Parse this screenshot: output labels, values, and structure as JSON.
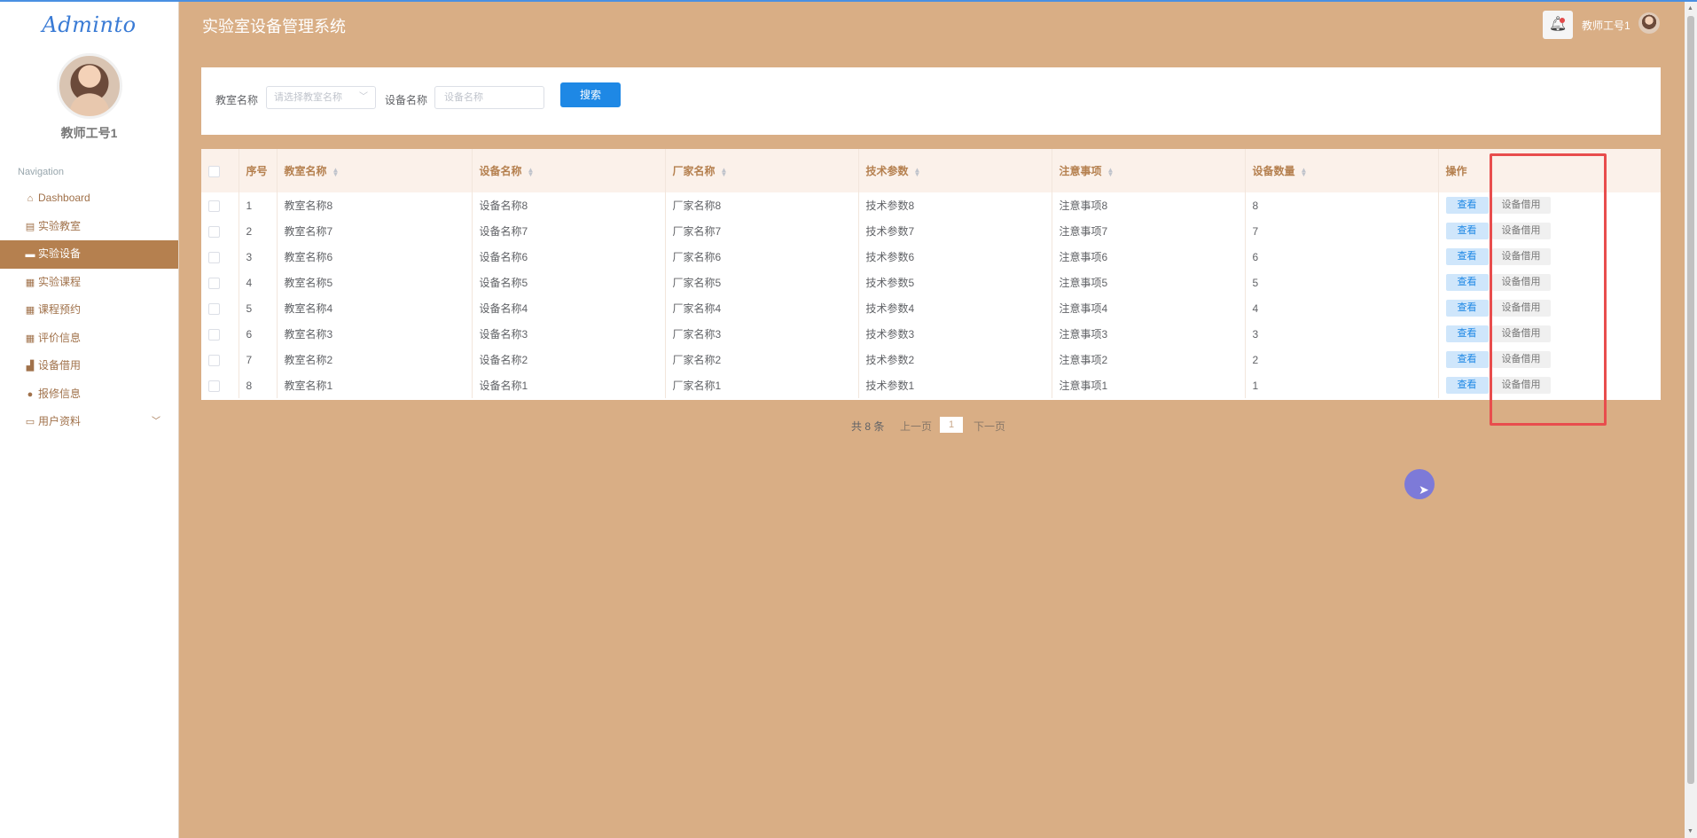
{
  "sidebar": {
    "logo": "Adminto",
    "user_name": "教师工号1",
    "nav_title": "Navigation",
    "items": [
      {
        "label": "Dashboard",
        "icon": "home-icon"
      },
      {
        "label": "实验教室",
        "icon": "clipboard-icon"
      },
      {
        "label": "实验设备",
        "icon": "ticket-icon",
        "active": true
      },
      {
        "label": "实验课程",
        "icon": "grid-icon"
      },
      {
        "label": "课程预约",
        "icon": "grid-icon"
      },
      {
        "label": "评价信息",
        "icon": "grid-icon"
      },
      {
        "label": "设备借用",
        "icon": "thumbs-up-icon"
      },
      {
        "label": "报修信息",
        "icon": "user-icon"
      },
      {
        "label": "用户资料",
        "icon": "card-icon"
      }
    ]
  },
  "header": {
    "title": "实验室设备管理系统",
    "user": "教师工号1"
  },
  "search": {
    "classroom_label": "教室名称",
    "classroom_placeholder": "请选择教室名称",
    "device_label": "设备名称",
    "device_placeholder": "设备名称",
    "button": "搜索"
  },
  "table": {
    "columns": [
      "序号",
      "教室名称",
      "设备名称",
      "厂家名称",
      "技术参数",
      "注意事项",
      "设备数量",
      "操作"
    ],
    "rows": [
      [
        "1",
        "教室名称8",
        "设备名称8",
        "厂家名称8",
        "技术参数8",
        "注意事项8",
        "8"
      ],
      [
        "2",
        "教室名称7",
        "设备名称7",
        "厂家名称7",
        "技术参数7",
        "注意事项7",
        "7"
      ],
      [
        "3",
        "教室名称6",
        "设备名称6",
        "厂家名称6",
        "技术参数6",
        "注意事项6",
        "6"
      ],
      [
        "4",
        "教室名称5",
        "设备名称5",
        "厂家名称5",
        "技术参数5",
        "注意事项5",
        "5"
      ],
      [
        "5",
        "教室名称4",
        "设备名称4",
        "厂家名称4",
        "技术参数4",
        "注意事项4",
        "4"
      ],
      [
        "6",
        "教室名称3",
        "设备名称3",
        "厂家名称3",
        "技术参数3",
        "注意事项3",
        "3"
      ],
      [
        "7",
        "教室名称2",
        "设备名称2",
        "厂家名称2",
        "技术参数2",
        "注意事项2",
        "2"
      ],
      [
        "8",
        "教室名称1",
        "设备名称1",
        "厂家名称1",
        "技术参数1",
        "注意事项1",
        "1"
      ]
    ],
    "view_label": "查看",
    "borrow_label": "设备借用"
  },
  "pagination": {
    "total": "共 8 条",
    "prev": "上一页",
    "current": "1",
    "next": "下一页"
  },
  "colors": {
    "background": "#d9ae85",
    "accent": "#b5804f",
    "primary_button": "#1e88e5",
    "highlight_box": "#e84d4d",
    "cursor_dot": "#7d7ad8"
  }
}
